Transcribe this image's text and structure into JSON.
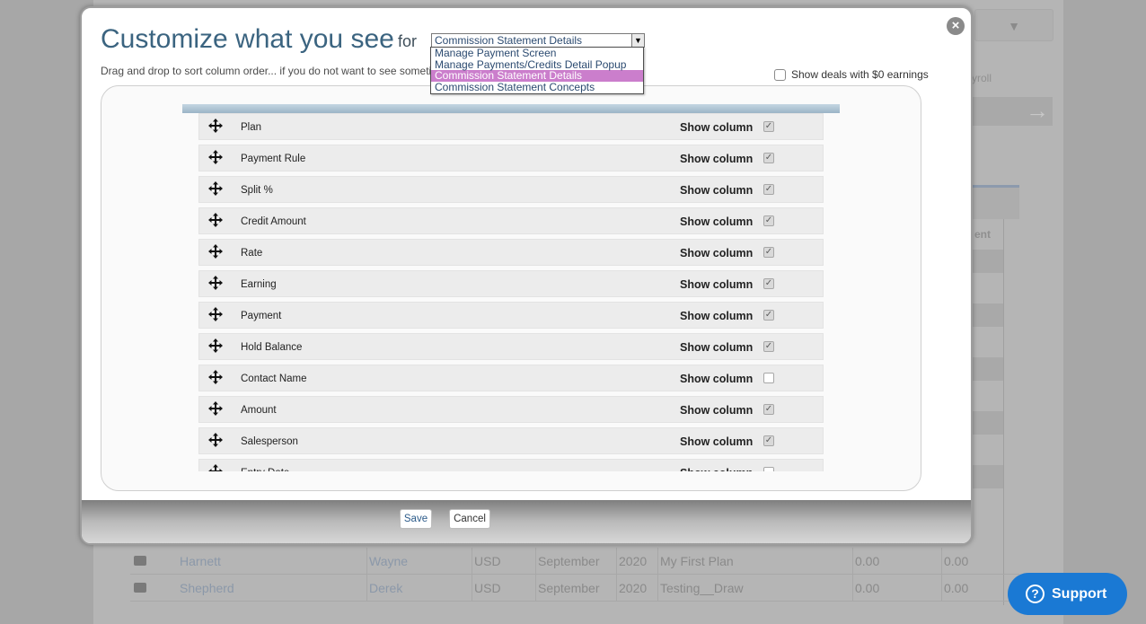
{
  "modal": {
    "title": "Customize what you see",
    "for_label": "for",
    "selected_view": "Commission Statement Details",
    "hint": "Drag and drop to sort column order... if you do not want to see someti",
    "zero_earnings_label": "Show deals with $0 earnings",
    "zero_earnings_checked": false,
    "close_icon": "×",
    "save_label": "Save",
    "cancel_label": "Cancel",
    "show_column_label": "Show column",
    "columns": [
      {
        "name": "Plan",
        "shown": true
      },
      {
        "name": "Payment Rule",
        "shown": true
      },
      {
        "name": "Split %",
        "shown": true
      },
      {
        "name": "Credit Amount",
        "shown": true
      },
      {
        "name": "Rate",
        "shown": true
      },
      {
        "name": "Earning",
        "shown": true
      },
      {
        "name": "Payment",
        "shown": true
      },
      {
        "name": "Hold Balance",
        "shown": true
      },
      {
        "name": "Contact Name",
        "shown": false
      },
      {
        "name": "Amount",
        "shown": true
      },
      {
        "name": "Salesperson",
        "shown": true
      },
      {
        "name": "Entry Date",
        "shown": false
      }
    ]
  },
  "dropdown": {
    "options": [
      "Manage Payment Screen",
      "Manage Payments/Credits Detail Popup",
      "Commission Statement Details",
      "Commission Statement Concepts"
    ],
    "selected_index": 2,
    "highlight_color": "#cb7ecc"
  },
  "background": {
    "tab_label": "yroll",
    "column_fragment": "ent",
    "rows": [
      {
        "last": "Harnett",
        "first": "Wayne",
        "currency": "USD",
        "month": "September",
        "year": "2020",
        "plan": "My First Plan",
        "v1": "0.00",
        "v2": "0.00"
      },
      {
        "last": "Shepherd",
        "first": "Derek",
        "currency": "USD",
        "month": "September",
        "year": "2020",
        "plan": "Testing__Draw",
        "v1": "0.00",
        "v2": "0.00"
      }
    ]
  },
  "support": {
    "label": "Support",
    "icon": "?",
    "color": "#1a79d4"
  }
}
